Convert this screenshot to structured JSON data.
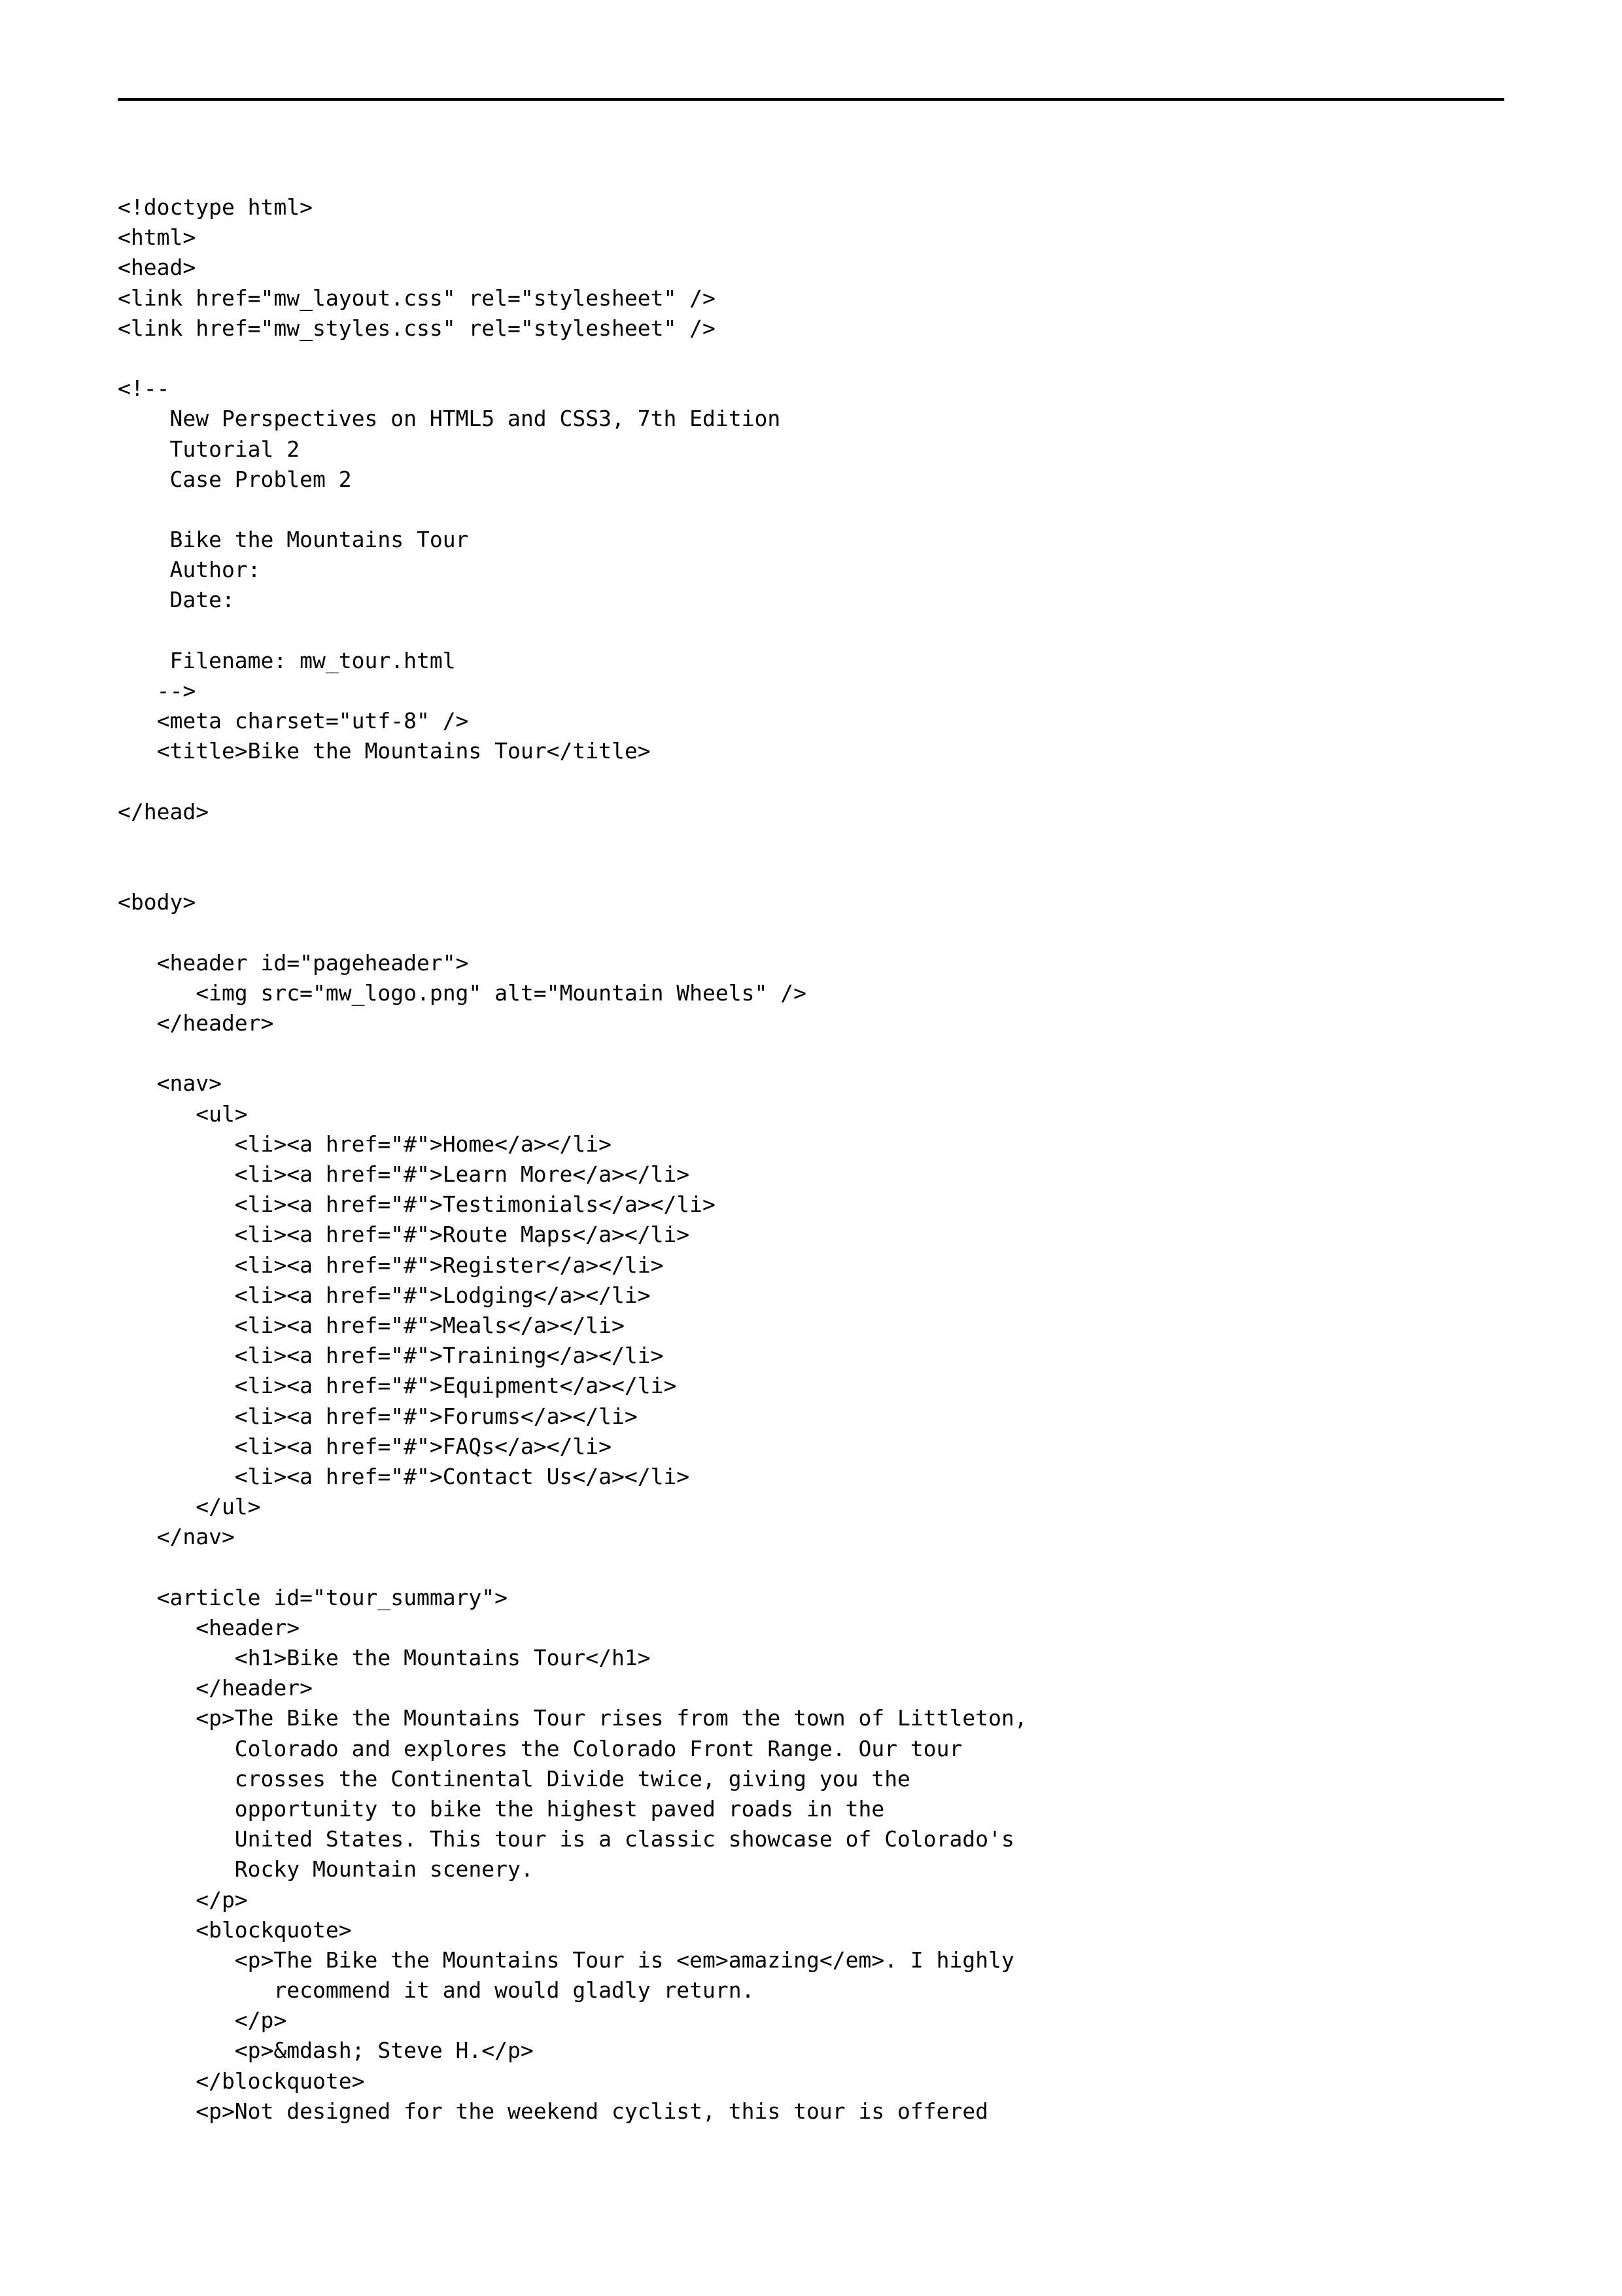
{
  "code_lines": [
    "<!doctype html>",
    "<html>",
    "<head>",
    "<link href=\"mw_layout.css\" rel=\"stylesheet\" />",
    "<link href=\"mw_styles.css\" rel=\"stylesheet\" />",
    "",
    "<!--",
    "    New Perspectives on HTML5 and CSS3, 7th Edition",
    "    Tutorial 2",
    "    Case Problem 2",
    "",
    "    Bike the Mountains Tour",
    "    Author:",
    "    Date:",
    "",
    "    Filename: mw_tour.html",
    "   -->",
    "   <meta charset=\"utf-8\" />",
    "   <title>Bike the Mountains Tour</title>",
    "",
    "</head>",
    "",
    "",
    "<body>",
    "",
    "   <header id=\"pageheader\">",
    "      <img src=\"mw_logo.png\" alt=\"Mountain Wheels\" />",
    "   </header>",
    "",
    "   <nav>",
    "      <ul>",
    "         <li><a href=\"#\">Home</a></li>",
    "         <li><a href=\"#\">Learn More</a></li>",
    "         <li><a href=\"#\">Testimonials</a></li>",
    "         <li><a href=\"#\">Route Maps</a></li>",
    "         <li><a href=\"#\">Register</a></li>",
    "         <li><a href=\"#\">Lodging</a></li>",
    "         <li><a href=\"#\">Meals</a></li>",
    "         <li><a href=\"#\">Training</a></li>",
    "         <li><a href=\"#\">Equipment</a></li>",
    "         <li><a href=\"#\">Forums</a></li>",
    "         <li><a href=\"#\">FAQs</a></li>",
    "         <li><a href=\"#\">Contact Us</a></li>",
    "      </ul>",
    "   </nav>",
    "",
    "   <article id=\"tour_summary\">",
    "      <header>",
    "         <h1>Bike the Mountains Tour</h1>",
    "      </header>",
    "      <p>The Bike the Mountains Tour rises from the town of Littleton,",
    "         Colorado and explores the Colorado Front Range. Our tour",
    "         crosses the Continental Divide twice, giving you the",
    "         opportunity to bike the highest paved roads in the",
    "         United States. This tour is a classic showcase of Colorado's",
    "         Rocky Mountain scenery.",
    "      </p>",
    "      <blockquote>",
    "         <p>The Bike the Mountains Tour is <em>amazing</em>. I highly",
    "            recommend it and would gladly return.",
    "         </p>",
    "         <p>&mdash; Steve H.</p>",
    "      </blockquote>",
    "      <p>Not designed for the weekend cyclist, this tour is offered"
  ]
}
